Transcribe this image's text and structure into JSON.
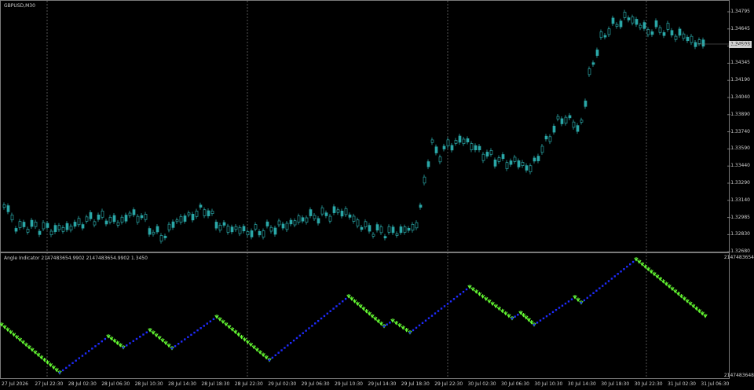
{
  "symbol_timeframe": "GBPUSD,M30",
  "indicator_title": "Angle Indicator 2147483654.9902 2147483654.9902 1.3450",
  "current_price": "1.34503",
  "price_levels": [
    "1.34795",
    "1.34645",
    "1.34495",
    "1.34345",
    "1.34190",
    "1.34040",
    "1.33890",
    "1.33740",
    "1.33590",
    "1.33440",
    "1.33290",
    "1.33140",
    "1.32985",
    "1.32830",
    "1.32680"
  ],
  "indicator_levels": [
    "2147483654",
    "2147483648"
  ],
  "time_labels": [
    "27 Jul 2026",
    "27 Jul 22:30",
    "28 Jul 02:30",
    "28 Jul 06:30",
    "28 Jul 10:30",
    "28 Jul 14:30",
    "28 Jul 18:30",
    "28 Jul 22:30",
    "29 Jul 02:30",
    "29 Jul 06:30",
    "29 Jul 10:30",
    "29 Jul 14:30",
    "29 Jul 18:30",
    "29 Jul 22:30",
    "30 Jul 02:30",
    "30 Jul 06:30",
    "30 Jul 10:30",
    "30 Jul 14:30",
    "30 Jul 18:30",
    "30 Jul 22:30",
    "31 Jul 02:30",
    "31 Jul 06:30"
  ],
  "colors": {
    "background": "#000000",
    "candle": "#2aa7a7",
    "text": "#cfcfcf",
    "grid": "#7a7a7a",
    "up_line": "#1f2bff",
    "down_arrow": "#66ff33"
  }
}
